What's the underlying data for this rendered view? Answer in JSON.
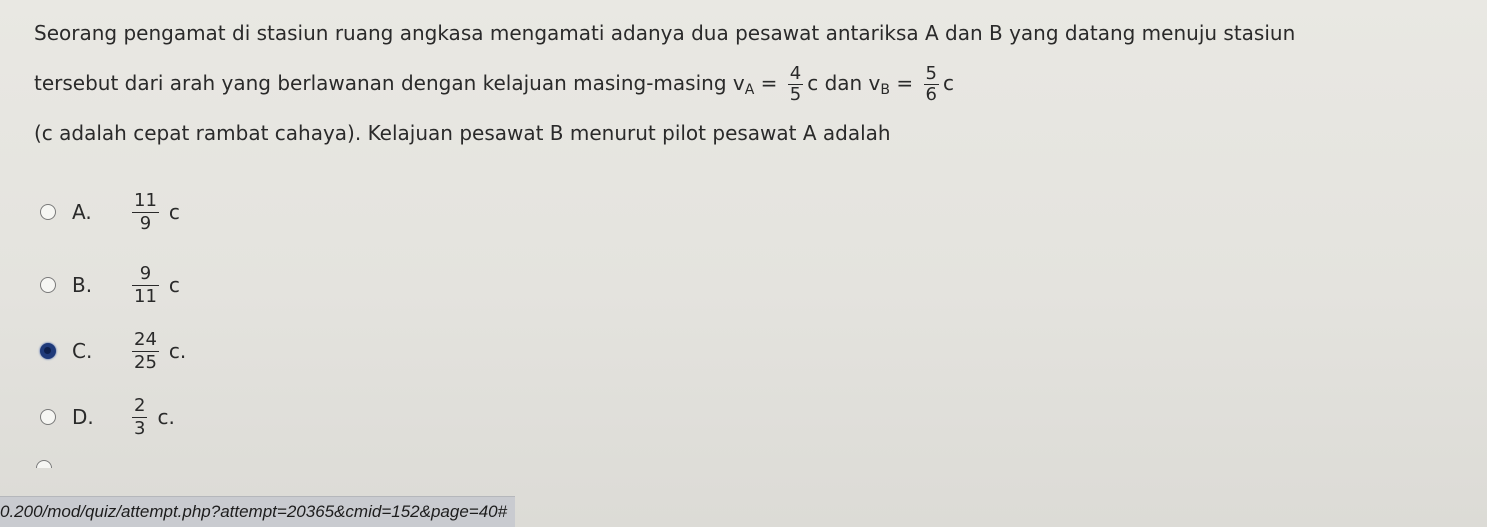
{
  "question": {
    "line1": "Seorang pengamat di stasiun ruang angkasa mengamati adanya dua pesawat antariksa A dan B yang datang menuju stasiun",
    "line2_prefix": "tersebut dari arah yang berlawanan dengan kelajuan masing-masing v",
    "va_sub": "A",
    "eq": "=",
    "va_num": "4",
    "va_den": "5",
    "c_dan": "c dan v",
    "vb_sub": "B",
    "vb_num": "5",
    "vb_den": "6",
    "c": "c",
    "line3": "(c adalah cepat rambat cahaya). Kelajuan pesawat B menurut pilot pesawat A adalah"
  },
  "options": [
    {
      "letter": "A.",
      "num": "11",
      "den": "9",
      "unit": "c",
      "selected": false
    },
    {
      "letter": "B.",
      "num": "9",
      "den": "11",
      "unit": "c",
      "selected": false
    },
    {
      "letter": "C.",
      "num": "24",
      "den": "25",
      "unit": "c.",
      "selected": true
    },
    {
      "letter": "D.",
      "num": "2",
      "den": "3",
      "unit": "c.",
      "selected": false
    }
  ],
  "status_url": "0.200/mod/quiz/attempt.php?attempt=20365&cmid=152&page=40#"
}
